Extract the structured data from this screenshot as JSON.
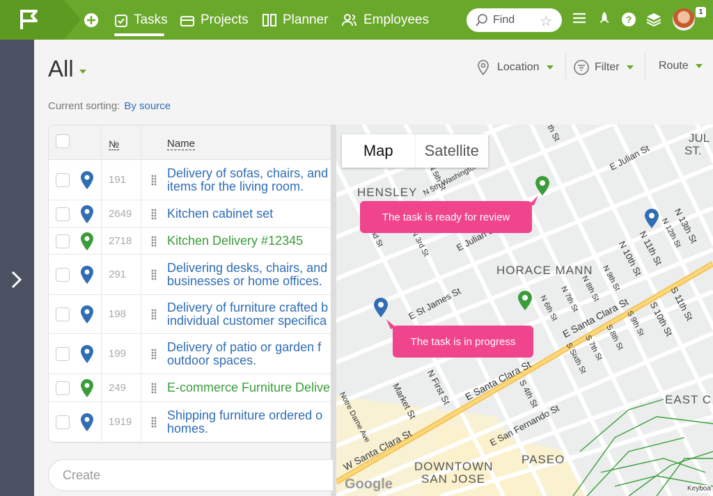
{
  "nav": {
    "items": [
      {
        "label": "Tasks"
      },
      {
        "label": "Projects"
      },
      {
        "label": "Planner"
      },
      {
        "label": "Employees"
      }
    ],
    "search_placeholder": "Find",
    "notification_count": "1"
  },
  "page": {
    "title": "All",
    "location_label": "Location",
    "filter_label": "Filter",
    "route_label": "Route",
    "sorting_label": "Current sorting:",
    "sorting_value": "By source",
    "create_placeholder": "Create"
  },
  "table": {
    "col_number": "№",
    "col_name": "Name",
    "rows": [
      {
        "num": "191",
        "name1": "Delivery of sofas, chairs, and",
        "name2": "items for the living room.",
        "pin": "blue"
      },
      {
        "num": "2649",
        "name1": "Kitchen cabinet set",
        "name2": "",
        "pin": "blue"
      },
      {
        "num": "2718",
        "name1": "Kitchen Delivery #12345",
        "name2": "",
        "pin": "green"
      },
      {
        "num": "291",
        "name1": "Delivering desks, chairs, and",
        "name2": "businesses or home offices.",
        "pin": "blue"
      },
      {
        "num": "198",
        "name1": "Delivery of furniture crafted b",
        "name2": "individual customer specifica",
        "pin": "blue"
      },
      {
        "num": "199",
        "name1": "Delivery of patio or garden f",
        "name2": "outdoor spaces.",
        "pin": "blue"
      },
      {
        "num": "249",
        "name1": "E-commerce Furniture Delive",
        "name2": "",
        "pin": "green"
      },
      {
        "num": "1919",
        "name1": "Shipping furniture ordered o",
        "name2": "homes.",
        "pin": "blue"
      }
    ]
  },
  "map": {
    "tab_map": "Map",
    "tab_satellite": "Satellite",
    "callout_review": "The task is ready for review",
    "callout_progress": "The task is in progress",
    "labels": {
      "hensley": "HENSLEY",
      "horace_mann": "HORACE MANN",
      "downtown": "DOWNTOWN",
      "san_jose": "SAN JOSE",
      "paseo": "PASEO",
      "east_c": "EAST C",
      "jul": "JUL",
      "st": "ST.",
      "e_julian_st": "E Julian St",
      "e_julian_st2": "E Julian St",
      "n_5th_st": "N 5th St",
      "n_3rd_st": "N 3rd St",
      "n_13th_st": "N 13th St",
      "n_12th_st": "N 12th St",
      "n_11th_st": "N 11th St",
      "n_10th_st": "N 10th St",
      "n_9th_st": "N 9th St",
      "n_8th_st": "N 8th St",
      "n_7th_st": "N 7th St",
      "n_6th_st": "N 6th St",
      "s_11th_st": "S 11th St",
      "s_10th_st": "S 10th St",
      "s_9th_st": "S 9th St",
      "s_8th_st": "S 8th St",
      "s_7th_st": "S 7th St",
      "s_6th_st": "S Sixth St",
      "s_4th_st": "S 4th St",
      "e_st_james_st": "E St James St",
      "e_santa_clara_st": "E Santa Clara St",
      "e_santa_clara_st2": "E Santa Clara St",
      "e_santa_clara_st3": "E Santa Clara St",
      "w_santa_clara_st": "W Santa Clara St",
      "e_san_fernando_st": "E San Fernando St",
      "n_first_st": "N First St",
      "market_st": "Market St",
      "notre_dame_ave": "Notre Dame Ave",
      "washington_st": "N 5th Washington St",
      "nd_st": "nd St",
      "th_st": "th St",
      "keyboard": "Keyboa",
      "google": "Google"
    }
  },
  "colors": {
    "brand": "#6aa82c",
    "pin_blue": "#2f6db5",
    "pin_green": "#3a9c3a",
    "callout": "#f0458c"
  }
}
